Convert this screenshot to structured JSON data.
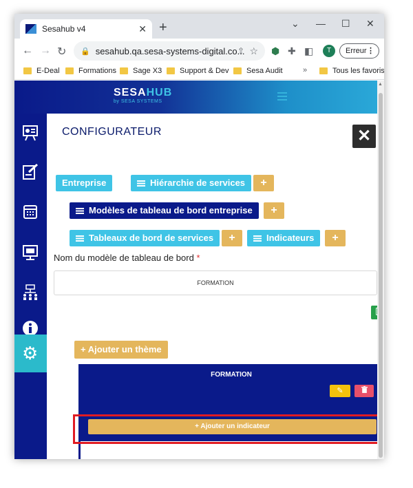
{
  "browser": {
    "tab_title": "Sesahub v4",
    "tab_close": "✕",
    "new_tab": "+",
    "window_controls": {
      "minimize": "⌄",
      "restore": "—",
      "maximize": "☐",
      "close": "✕"
    },
    "url": "sesahub.qa.sesa-systems-digital.co...",
    "profile_initial": "T",
    "error_label": "Erreur",
    "bookmarks": [
      "E-Deal",
      "Formations",
      "Sage X3",
      "Support & Dev",
      "Sesa Audit"
    ],
    "bookmarks_more": "»",
    "all_favorites": "Tous les favoris"
  },
  "app": {
    "logo_sesa": "SESA",
    "logo_hub": "HUB",
    "logo_sub": "by SESA SYSTEMS"
  },
  "main": {
    "title": "CONFIGURATEUR",
    "tabs": {
      "entreprise": "Entreprise",
      "hierarchie": "Hiérarchie de services",
      "modeles": "Modèles de tableau de bord entreprise",
      "tableaux": "Tableaux de bord de services",
      "indicateurs": "Indicateurs"
    },
    "plus": "+",
    "field_label": "Nom du modèle de tableau de bord",
    "required_mark": "*",
    "field_value": "FORMATION",
    "add_theme": "+ Ajouter un thème",
    "theme_title": "FORMATION",
    "add_indicator": "+ Ajouter un indicateur"
  },
  "colors": {
    "navy": "#0a1a8a",
    "cyan": "#3fc4e6",
    "gold": "#e4b65c",
    "highlight": "#e01b22"
  }
}
